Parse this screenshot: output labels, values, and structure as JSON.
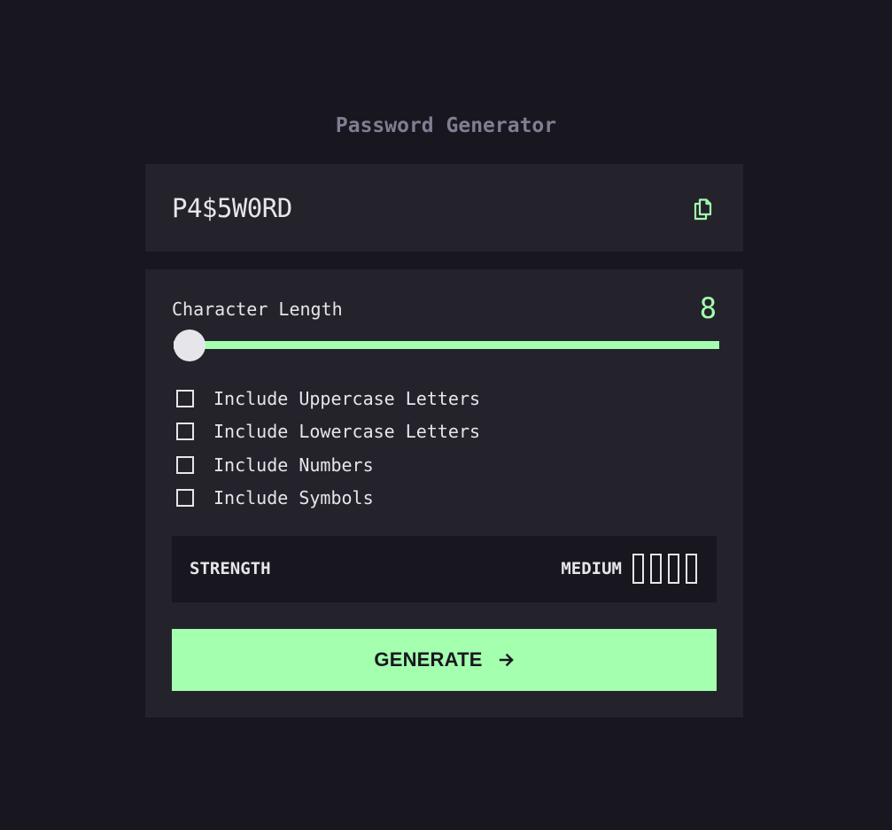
{
  "app": {
    "title": "Password Generator"
  },
  "password": {
    "value": "P4$5W0RD",
    "copy_icon": "copy-icon"
  },
  "length": {
    "label": "Character Length",
    "value": "8",
    "slider_fraction": 0
  },
  "options": [
    {
      "label": "Include Uppercase Letters",
      "checked": false
    },
    {
      "label": "Include Lowercase Letters",
      "checked": false
    },
    {
      "label": "Include Numbers",
      "checked": false
    },
    {
      "label": "Include Symbols",
      "checked": false
    }
  ],
  "strength": {
    "label": "STRENGTH",
    "level": "MEDIUM",
    "bars_filled": 0,
    "bars_total": 4
  },
  "generate": {
    "label": "GENERATE",
    "icon": "arrow-right-icon"
  },
  "colors": {
    "accent": "#a4ffaf",
    "background": "#18171f",
    "panel": "#24232c",
    "muted": "#817d92",
    "text": "#e6e5ea"
  }
}
